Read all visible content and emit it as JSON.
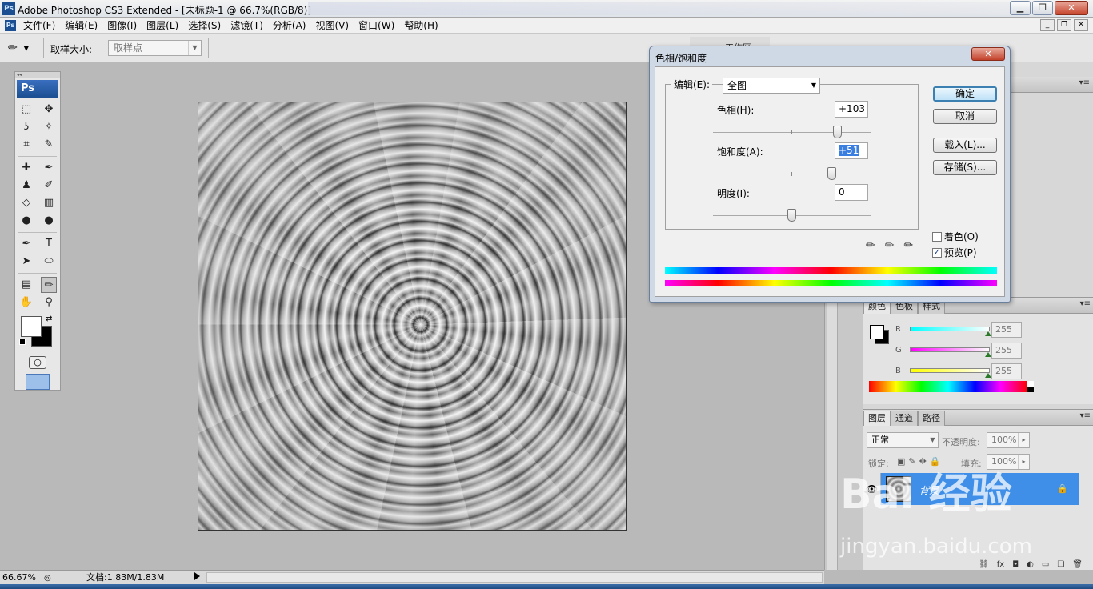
{
  "window": {
    "title": "Adobe Photoshop CS3 Extended - [未标题-1 @ 66.7%(RGB/8)]",
    "app_icon": "Ps"
  },
  "menu": [
    "文件(F)",
    "编辑(E)",
    "图像(I)",
    "图层(L)",
    "选择(S)",
    "滤镜(T)",
    "分析(A)",
    "视图(V)",
    "窗口(W)",
    "帮助(H)"
  ],
  "options": {
    "sample_size_label": "取样大小:",
    "sample_size_value": "取样点",
    "workspace_label": "工作区"
  },
  "toolbox": {
    "logo": "Ps",
    "tools": [
      [
        "marquee-tool",
        "move-tool"
      ],
      [
        "lasso-tool",
        "magic-wand-tool"
      ],
      [
        "crop-tool",
        "slice-tool"
      ],
      [
        "healing-brush-tool",
        "brush-tool"
      ],
      [
        "clone-stamp-tool",
        "history-brush-tool"
      ],
      [
        "eraser-tool",
        "gradient-tool"
      ],
      [
        "blur-tool",
        "dodge-tool"
      ],
      [
        "pen-tool",
        "type-tool"
      ],
      [
        "path-selection-tool",
        "shape-tool"
      ],
      [
        "notes-tool",
        "eyedropper-tool"
      ],
      [
        "hand-tool",
        "zoom-tool"
      ]
    ],
    "tool_glyphs": [
      [
        "⬚",
        "✥"
      ],
      [
        "ʖ",
        "✧"
      ],
      [
        "⌗",
        "✎"
      ],
      [
        "✚",
        "✒"
      ],
      [
        "♟",
        "✐"
      ],
      [
        "◇",
        "▥"
      ],
      [
        "●",
        "●"
      ],
      [
        "✒",
        "T"
      ],
      [
        "➤",
        "⬭"
      ],
      [
        "▤",
        "✏"
      ],
      [
        "✋",
        "⚲"
      ]
    ],
    "foreground_color": "#ffffff",
    "background_color": "#000000"
  },
  "dialog": {
    "title": "色相/饱和度",
    "edit_label": "编辑(E):",
    "edit_value": "全图",
    "hue_label": "色相(H):",
    "hue_value": "+103",
    "saturation_label": "饱和度(A):",
    "saturation_value": "+51",
    "lightness_label": "明度(I):",
    "lightness_value": "0",
    "hue_slider": 103,
    "saturation_slider": 51,
    "lightness_slider": 0,
    "slider_range": [
      -100,
      100
    ],
    "hue_range": [
      -180,
      180
    ],
    "ok_label": "确定",
    "cancel_label": "取消",
    "load_label": "载入(L)...",
    "save_label": "存储(S)...",
    "colorize_label": "着色(O)",
    "colorize_checked": false,
    "preview_label": "预览(P)",
    "preview_checked": true
  },
  "color_panel": {
    "tabs": [
      "颜色",
      "色板",
      "样式"
    ],
    "channels": [
      {
        "name": "R",
        "value": "255",
        "color": "#00ffff"
      },
      {
        "name": "G",
        "value": "255",
        "color": "#ff00ff"
      },
      {
        "name": "B",
        "value": "255",
        "color": "#ffff00"
      }
    ]
  },
  "layers_panel": {
    "tabs": [
      "图层",
      "通道",
      "路径"
    ],
    "blend_mode": "正常",
    "opacity_label": "不透明度:",
    "opacity_value": "100%",
    "lock_label": "锁定:",
    "fill_label": "填充:",
    "fill_value": "100%",
    "layer_name": "背景"
  },
  "status": {
    "zoom": "66.67%",
    "doc_info": "文档:1.83M/1.83M"
  },
  "watermark": {
    "brand": "Bai 经验",
    "url": "jingyan.baidu.com"
  }
}
